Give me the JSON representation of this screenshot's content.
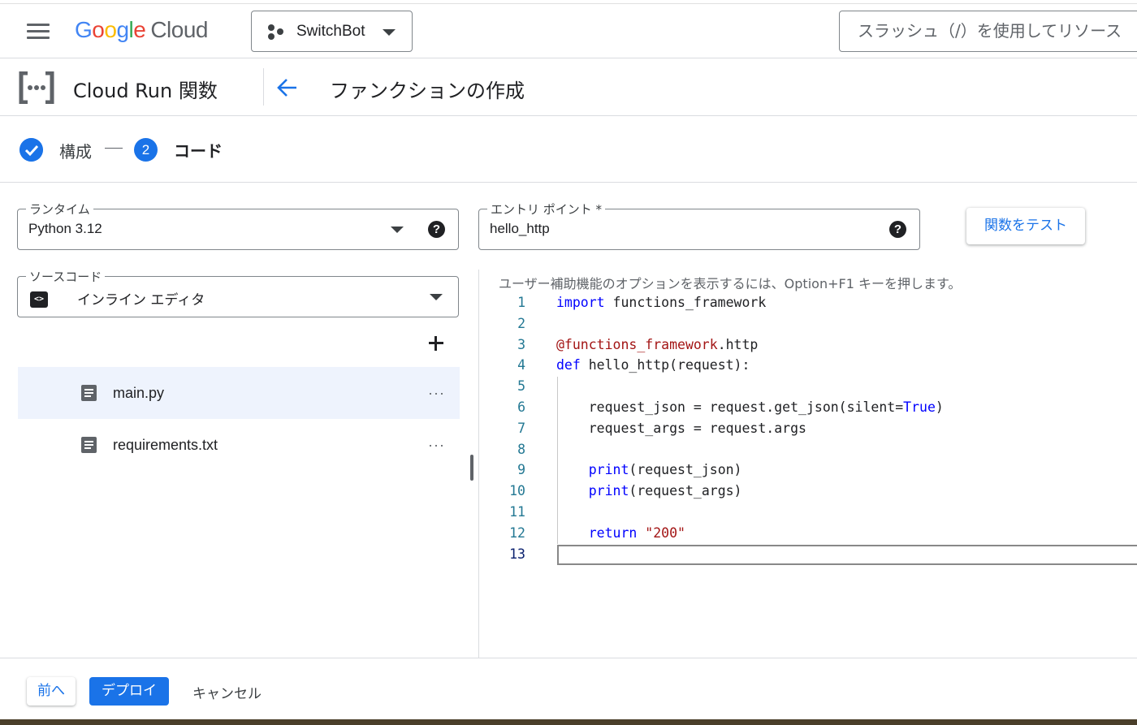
{
  "header": {
    "logo_google": "Google",
    "logo_cloud": "Cloud",
    "project_name": "SwitchBot",
    "search_placeholder": "スラッシュ（/）を使用してリソース"
  },
  "product": {
    "name": "Cloud Run 関数",
    "page_title": "ファンクションの作成"
  },
  "stepper": {
    "step1_label": "構成",
    "step2_number": "2",
    "step2_label": "コード"
  },
  "runtime": {
    "label": "ランタイム",
    "value": "Python 3.12"
  },
  "entry_point": {
    "label": "エントリ ポイント *",
    "value": "hello_http"
  },
  "test_button": "関数をテスト",
  "source": {
    "label": "ソースコード",
    "value": "インライン エディタ",
    "icon_text": "<>"
  },
  "files": [
    {
      "name": "main.py",
      "menu": "···",
      "selected": true
    },
    {
      "name": "requirements.txt",
      "menu": "···",
      "selected": false
    }
  ],
  "editor": {
    "a11y_hint": "ユーザー補助機能のオプションを表示するには、Option+F1 キーを押します。",
    "active_line": 13,
    "lines": [
      "import functions_framework",
      "",
      "@functions_framework.http",
      "def hello_http(request):",
      "",
      "    request_json = request.get_json(silent=True)",
      "    request_args = request.args",
      "",
      "    print(request_json)",
      "    print(request_args)",
      "",
      "    return \"200\"",
      ""
    ]
  },
  "footer": {
    "prev_label": "前へ",
    "deploy_label": "デプロイ",
    "cancel_label": "キャンセル"
  },
  "colors": {
    "accent": "#1a73e8",
    "keyword": "#0000ff",
    "string": "#a31515",
    "line_number": "#237893"
  }
}
